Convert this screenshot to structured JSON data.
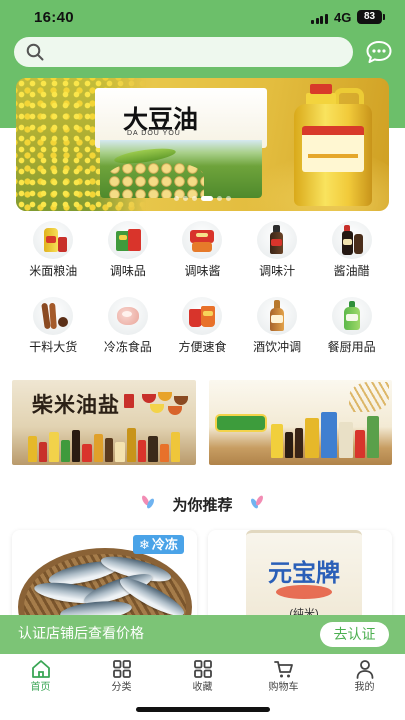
{
  "status_bar": {
    "time": "16:40",
    "network": "4G",
    "battery_level": "83"
  },
  "header": {
    "search_icon": "search-icon",
    "message_icon": "message-icon"
  },
  "banner": {
    "title": "大豆油",
    "subtitle": "DA DOU YOU",
    "slide_count": 6,
    "active_slide": 3
  },
  "categories": [
    {
      "label": "米面粮油",
      "icon": "cooking-oil-icon"
    },
    {
      "label": "调味品",
      "icon": "seasoning-icon"
    },
    {
      "label": "调味酱",
      "icon": "sauce-icon"
    },
    {
      "label": "调味汁",
      "icon": "dressing-bottle-icon"
    },
    {
      "label": "酱油醋",
      "icon": "soy-sauce-icon"
    },
    {
      "label": "干料大货",
      "icon": "dried-spice-icon"
    },
    {
      "label": "冷冻食品",
      "icon": "frozen-food-icon"
    },
    {
      "label": "方便速食",
      "icon": "instant-noodle-icon"
    },
    {
      "label": "酒饮冲调",
      "icon": "beverage-icon"
    },
    {
      "label": "餐厨用品",
      "icon": "kitchen-supplies-icon"
    }
  ],
  "promos": [
    {
      "title": "柴米油盐"
    },
    {}
  ],
  "recommend": {
    "title": "为你推荐"
  },
  "products": [
    {
      "badge": "冷冻",
      "badge_icon": "snowflake-icon"
    },
    {
      "package_brand": "元宝牌",
      "package_label": "(纯米)"
    }
  ],
  "auth_bar": {
    "message": "认证店铺后查看价格",
    "button": "去认证"
  },
  "tabs": [
    {
      "label": "首页",
      "icon": "home-icon",
      "active": true
    },
    {
      "label": "分类",
      "icon": "category-grid-icon",
      "active": false
    },
    {
      "label": "收藏",
      "icon": "favorites-grid-icon",
      "active": false
    },
    {
      "label": "购物车",
      "icon": "cart-icon",
      "active": false
    },
    {
      "label": "我的",
      "icon": "profile-icon",
      "active": false
    }
  ],
  "colors": {
    "header_green": "#6cbf6a",
    "active_tab": "#3aa655",
    "badge_blue": "#4aa3e8",
    "auth_bar": "#7cc476"
  }
}
